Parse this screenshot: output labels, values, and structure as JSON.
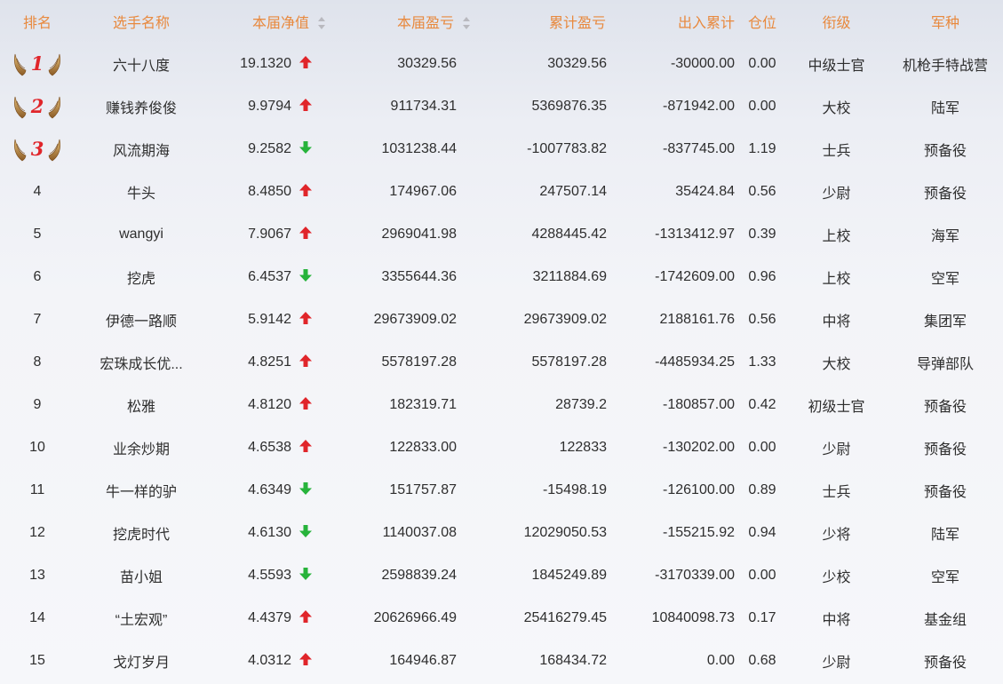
{
  "header": {
    "rank": "排名",
    "name": "选手名称",
    "nav": "本届净值",
    "profit": "本届盈亏",
    "cum_profit": "累计盈亏",
    "flow": "出入累计",
    "position": "仓位",
    "title": "衔级",
    "corps": "军种"
  },
  "colors": {
    "header_text": "#e8893e",
    "up_arrow": "#e0252a",
    "down_arrow": "#27b33b",
    "medal_wing": "#c08a3e",
    "medal_number": "#e0252a"
  },
  "rows": [
    {
      "rank": "1",
      "medal": true,
      "name": "六十八度",
      "nav": "19.1320",
      "trend": "up",
      "profit": "30329.56",
      "cum_profit": "30329.56",
      "flow": "-30000.00",
      "position": "0.00",
      "title": "中级士官",
      "corps": "机枪手特战营"
    },
    {
      "rank": "2",
      "medal": true,
      "name": "赚钱养俊俊",
      "nav": "9.9794",
      "trend": "up",
      "profit": "911734.31",
      "cum_profit": "5369876.35",
      "flow": "-871942.00",
      "position": "0.00",
      "title": "大校",
      "corps": "陆军"
    },
    {
      "rank": "3",
      "medal": true,
      "name": "风流期海",
      "nav": "9.2582",
      "trend": "down",
      "profit": "1031238.44",
      "cum_profit": "-1007783.82",
      "flow": "-837745.00",
      "position": "1.19",
      "title": "士兵",
      "corps": "预备役"
    },
    {
      "rank": "4",
      "medal": false,
      "name": "牛头",
      "nav": "8.4850",
      "trend": "up",
      "profit": "174967.06",
      "cum_profit": "247507.14",
      "flow": "35424.84",
      "position": "0.56",
      "title": "少尉",
      "corps": "预备役"
    },
    {
      "rank": "5",
      "medal": false,
      "name": "wangyi",
      "nav": "7.9067",
      "trend": "up",
      "profit": "2969041.98",
      "cum_profit": "4288445.42",
      "flow": "-1313412.97",
      "position": "0.39",
      "title": "上校",
      "corps": "海军"
    },
    {
      "rank": "6",
      "medal": false,
      "name": "挖虎",
      "nav": "6.4537",
      "trend": "down",
      "profit": "3355644.36",
      "cum_profit": "3211884.69",
      "flow": "-1742609.00",
      "position": "0.96",
      "title": "上校",
      "corps": "空军"
    },
    {
      "rank": "7",
      "medal": false,
      "name": "伊德一路顺",
      "nav": "5.9142",
      "trend": "up",
      "profit": "29673909.02",
      "cum_profit": "29673909.02",
      "flow": "2188161.76",
      "position": "0.56",
      "title": "中将",
      "corps": "集团军"
    },
    {
      "rank": "8",
      "medal": false,
      "name": "宏珠成长优...",
      "nav": "4.8251",
      "trend": "up",
      "profit": "5578197.28",
      "cum_profit": "5578197.28",
      "flow": "-4485934.25",
      "position": "1.33",
      "title": "大校",
      "corps": "导弹部队"
    },
    {
      "rank": "9",
      "medal": false,
      "name": "松雅",
      "nav": "4.8120",
      "trend": "up",
      "profit": "182319.71",
      "cum_profit": "28739.2",
      "flow": "-180857.00",
      "position": "0.42",
      "title": "初级士官",
      "corps": "预备役"
    },
    {
      "rank": "10",
      "medal": false,
      "name": "业余炒期",
      "nav": "4.6538",
      "trend": "up",
      "profit": "122833.00",
      "cum_profit": "122833",
      "flow": "-130202.00",
      "position": "0.00",
      "title": "少尉",
      "corps": "预备役"
    },
    {
      "rank": "11",
      "medal": false,
      "name": "牛一样的驴",
      "nav": "4.6349",
      "trend": "down",
      "profit": "151757.87",
      "cum_profit": "-15498.19",
      "flow": "-126100.00",
      "position": "0.89",
      "title": "士兵",
      "corps": "预备役"
    },
    {
      "rank": "12",
      "medal": false,
      "name": "挖虎时代",
      "nav": "4.6130",
      "trend": "down",
      "profit": "1140037.08",
      "cum_profit": "12029050.53",
      "flow": "-155215.92",
      "position": "0.94",
      "title": "少将",
      "corps": "陆军"
    },
    {
      "rank": "13",
      "medal": false,
      "name": "苗小姐",
      "nav": "4.5593",
      "trend": "down",
      "profit": "2598839.24",
      "cum_profit": "1845249.89",
      "flow": "-3170339.00",
      "position": "0.00",
      "title": "少校",
      "corps": "空军"
    },
    {
      "rank": "14",
      "medal": false,
      "name": "“土宏观”",
      "nav": "4.4379",
      "trend": "up",
      "profit": "20626966.49",
      "cum_profit": "25416279.45",
      "flow": "10840098.73",
      "position": "0.17",
      "title": "中将",
      "corps": "基金组"
    },
    {
      "rank": "15",
      "medal": false,
      "name": "戈灯岁月",
      "nav": "4.0312",
      "trend": "up",
      "profit": "164946.87",
      "cum_profit": "168434.72",
      "flow": "0.00",
      "position": "0.68",
      "title": "少尉",
      "corps": "预备役"
    }
  ]
}
